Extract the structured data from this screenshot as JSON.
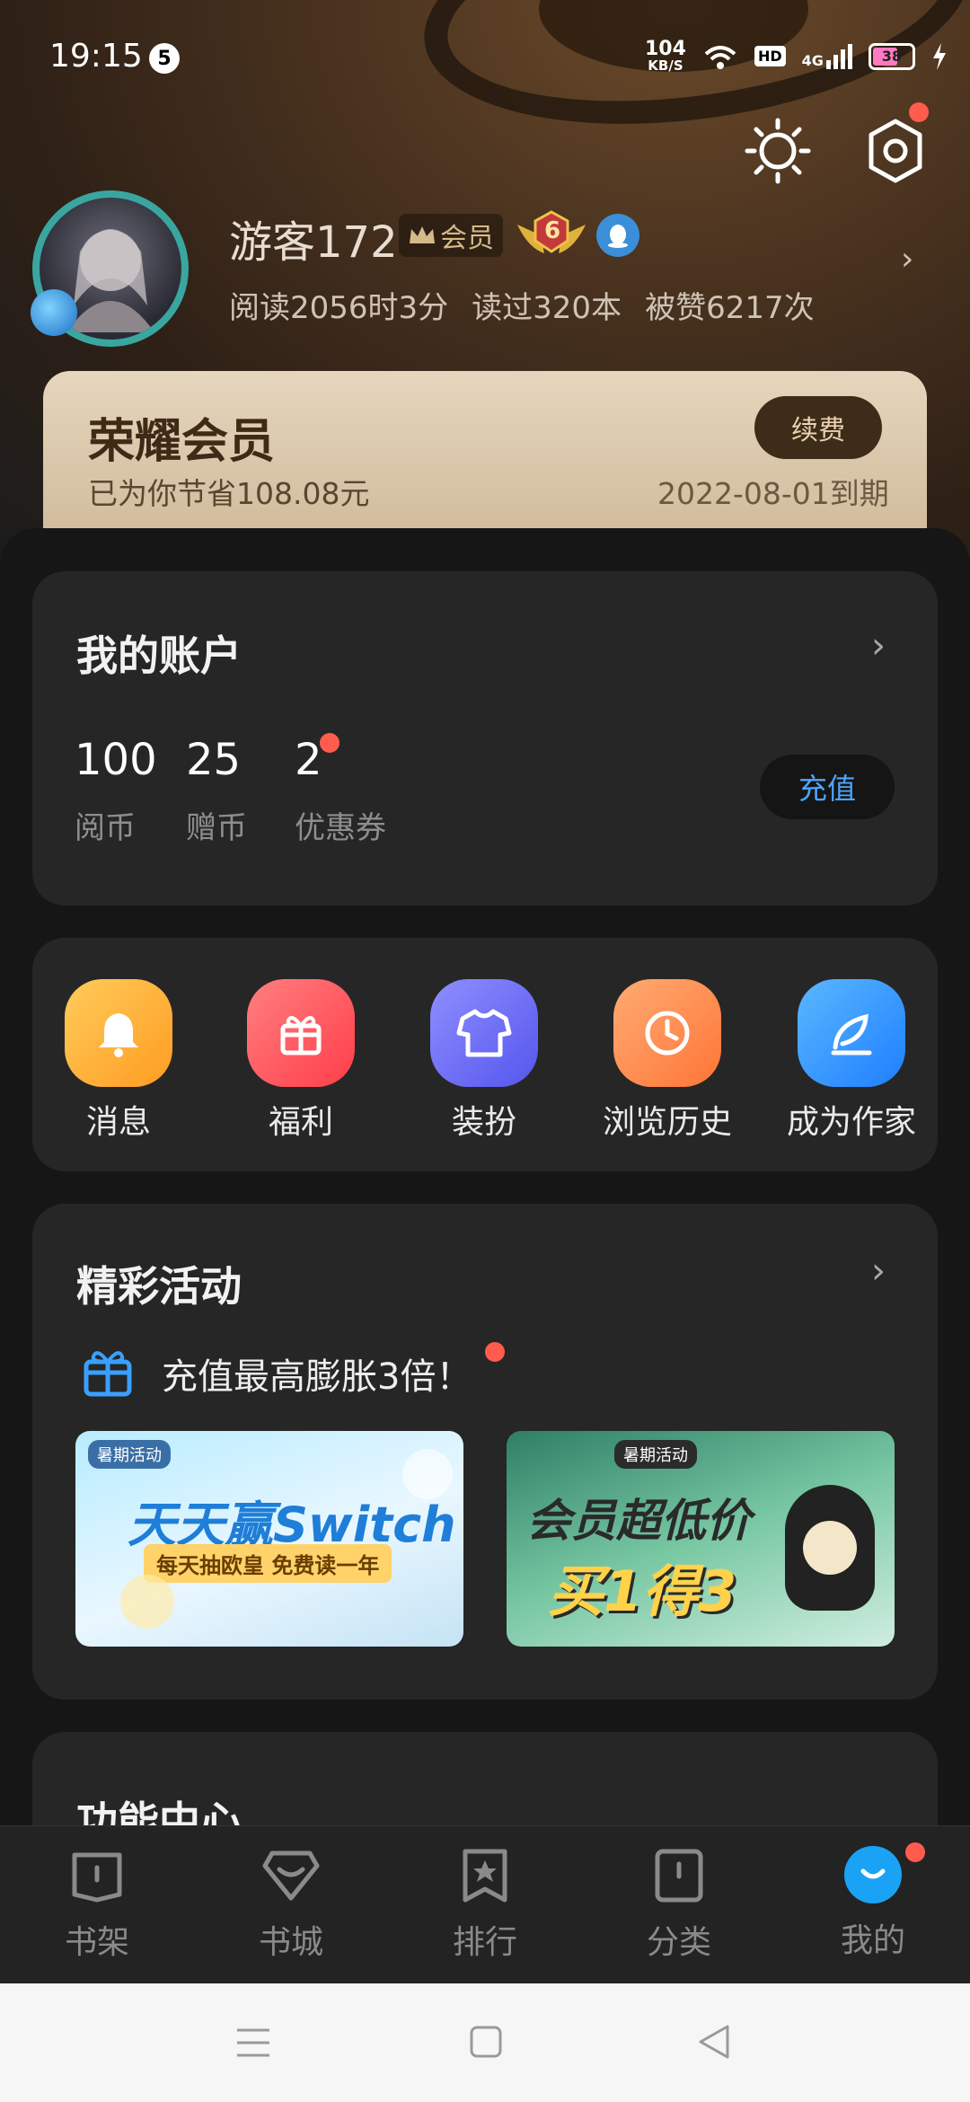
{
  "status_bar": {
    "time": "19:15",
    "notification_count": "5",
    "net_speed_top": "104",
    "net_speed_bottom": "KB/S",
    "hd": "HD",
    "network": "4G",
    "battery": "38"
  },
  "profile": {
    "username": "游客172",
    "vip_tag": "会员",
    "level": "6",
    "stats": [
      "阅读2056时3分",
      "读过320本",
      "被赞6217次"
    ]
  },
  "member_card": {
    "title": "荣耀会员",
    "saved": "已为你节省108.08元",
    "expiry": "2022-08-01到期",
    "renew_label": "续费"
  },
  "account": {
    "title": "我的账户",
    "items": [
      {
        "value": "100",
        "label": "阅币"
      },
      {
        "value": "25",
        "label": "赠币"
      },
      {
        "value": "2",
        "label": "优惠券"
      }
    ],
    "recharge_label": "充值"
  },
  "shortcuts": [
    {
      "label": "消息",
      "icon": "bell-icon",
      "color": "#ffb43a"
    },
    {
      "label": "福利",
      "icon": "gift-icon",
      "color": "#ff5e5e"
    },
    {
      "label": "装扮",
      "icon": "shirt-icon",
      "color": "#6b6bff"
    },
    {
      "label": "浏览历史",
      "icon": "clock-icon",
      "color": "#ff8a4a"
    },
    {
      "label": "成为作家",
      "icon": "feather-icon",
      "color": "#3aa0ff"
    }
  ],
  "activities": {
    "title": "精彩活动",
    "promo_text": "充值最高膨胀3倍！",
    "banners": [
      {
        "tag": "暑期活动",
        "headline": "天天赢Switch",
        "sub": "每天抽欧皇 免费读一年"
      },
      {
        "tag": "暑期活动",
        "headline": "会员超低价",
        "sub": "买1得3"
      }
    ]
  },
  "function_center": {
    "title": "功能中心"
  },
  "bottom_nav": [
    {
      "label": "书架",
      "icon": "bookshelf-icon"
    },
    {
      "label": "书城",
      "icon": "bookstore-icon"
    },
    {
      "label": "排行",
      "icon": "ranking-icon"
    },
    {
      "label": "分类",
      "icon": "category-icon"
    },
    {
      "label": "我的",
      "icon": "profile-icon"
    }
  ],
  "colors": {
    "accent_blue": "#4da6ff",
    "red_dot": "#ff5c4d",
    "member_gold": "#d6b98a"
  }
}
